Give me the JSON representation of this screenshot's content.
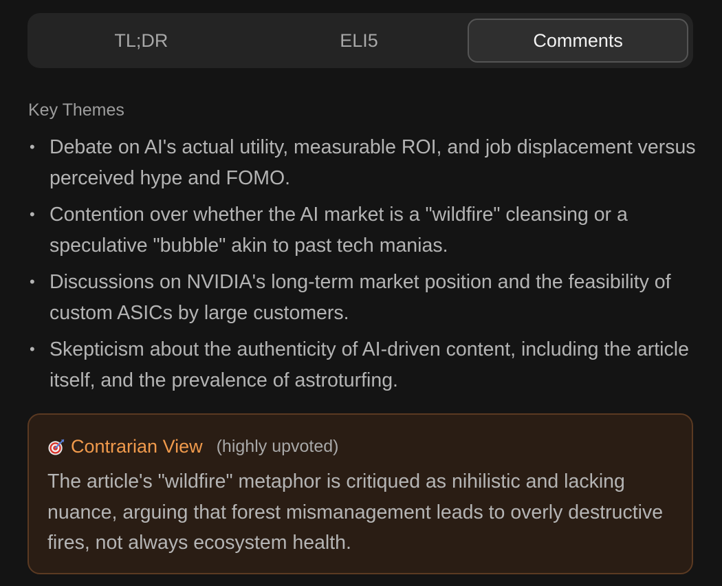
{
  "tabs": [
    {
      "label": "TL;DR",
      "active": false
    },
    {
      "label": "ELI5",
      "active": false
    },
    {
      "label": "Comments",
      "active": true
    }
  ],
  "section": {
    "title": "Key Themes"
  },
  "themes": [
    "Debate on AI's actual utility, measurable ROI, and job displacement versus perceived hype and FOMO.",
    "Contention over whether the AI market is a \"wildfire\" cleansing or a speculative \"bubble\" akin to past tech manias.",
    "Discussions on NVIDIA's long-term market position and the feasibility of custom ASICs by large customers.",
    "Skepticism about the authenticity of AI-driven content, including the article itself, and the prevalence of astroturfing."
  ],
  "callout": {
    "icon": "target-icon",
    "title": "Contrarian View",
    "subtitle": "(highly upvoted)",
    "body": "The article's \"wildfire\" metaphor is critiqued as nihilistic and lacking nuance, arguing that forest mismanagement leads to overly destructive fires, not always ecosystem health."
  },
  "colors": {
    "background": "#141414",
    "tab_bar": "#242424",
    "active_tab": "#2f2f2f",
    "accent_orange": "#f09a4c",
    "callout_bg": "#2a1d14",
    "callout_border": "#5b3a22"
  }
}
